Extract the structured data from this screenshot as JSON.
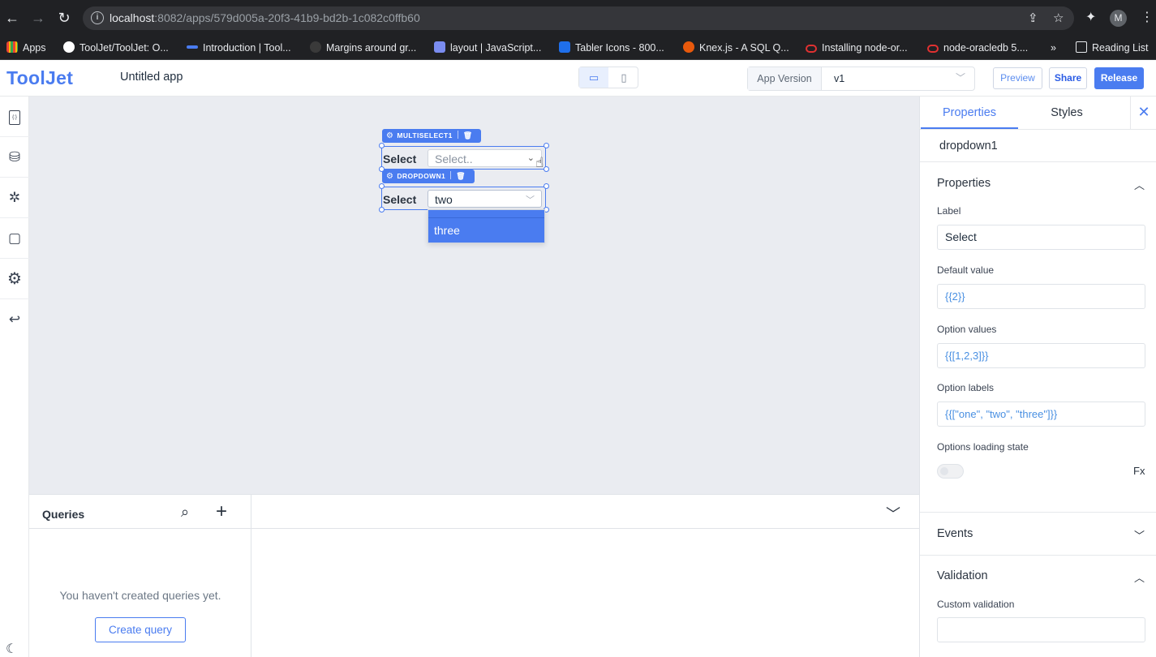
{
  "browser": {
    "url_host": "localhost",
    "url_rest": ":8082/apps/579d005a-20f3-41b9-bd2b-1c082c0ffb60",
    "profile_initial": "M",
    "bookmarks": [
      {
        "label": "Apps",
        "color": "#ea4335"
      },
      {
        "label": "ToolJet/ToolJet: O...",
        "color": "#ffffff"
      },
      {
        "label": "Introduction | Tool...",
        "color": "#4a7cf0"
      },
      {
        "label": "Margins around gr...",
        "color": "#3a3a3a"
      },
      {
        "label": "layout | JavaScript...",
        "color": "#7a8cf0"
      },
      {
        "label": "Tabler Icons - 800...",
        "color": "#1f6feb"
      },
      {
        "label": "Knex.js - A SQL Q...",
        "color": "#e8590c"
      },
      {
        "label": "Installing node-or...",
        "color": "#e03131"
      },
      {
        "label": "node-oracledb 5....",
        "color": "#e03131"
      }
    ],
    "more": "»",
    "reading_list": "Reading List"
  },
  "header": {
    "logo": "ToolJet",
    "app_name": "Untitled app",
    "version_label": "App Version",
    "version_value": "v1",
    "preview": "Preview",
    "share": "Share",
    "release": "Release"
  },
  "canvas": {
    "multiselect_tag": "MULTISELECT1",
    "multiselect_label": "Select",
    "multiselect_placeholder": "Select..",
    "dropdown_tag": "DROPDOWN1",
    "dropdown_label": "Select",
    "dropdown_value": "two",
    "dropdown_highlighted_option": "three"
  },
  "queries": {
    "title": "Queries",
    "empty_text": "You haven't created queries yet.",
    "create_button": "Create query"
  },
  "inspector": {
    "tab_properties": "Properties",
    "tab_styles": "Styles",
    "component_name": "dropdown1",
    "properties_section": "Properties",
    "label_field_label": "Label",
    "label_field_value": "Select",
    "default_value_label": "Default value",
    "default_value": "{{2}}",
    "option_values_label": "Option values",
    "option_values": "{{[1,2,3]}}",
    "option_labels_label": "Option labels",
    "option_labels": "{{[\"one\", \"two\", \"three\"]}}",
    "loading_state_label": "Options loading state",
    "fx": "Fx",
    "events_section": "Events",
    "validation_section": "Validation",
    "custom_validation_label": "Custom validation"
  },
  "colors": {
    "accent": "#4a7cf0",
    "canvas_bg": "#eaecf1"
  }
}
